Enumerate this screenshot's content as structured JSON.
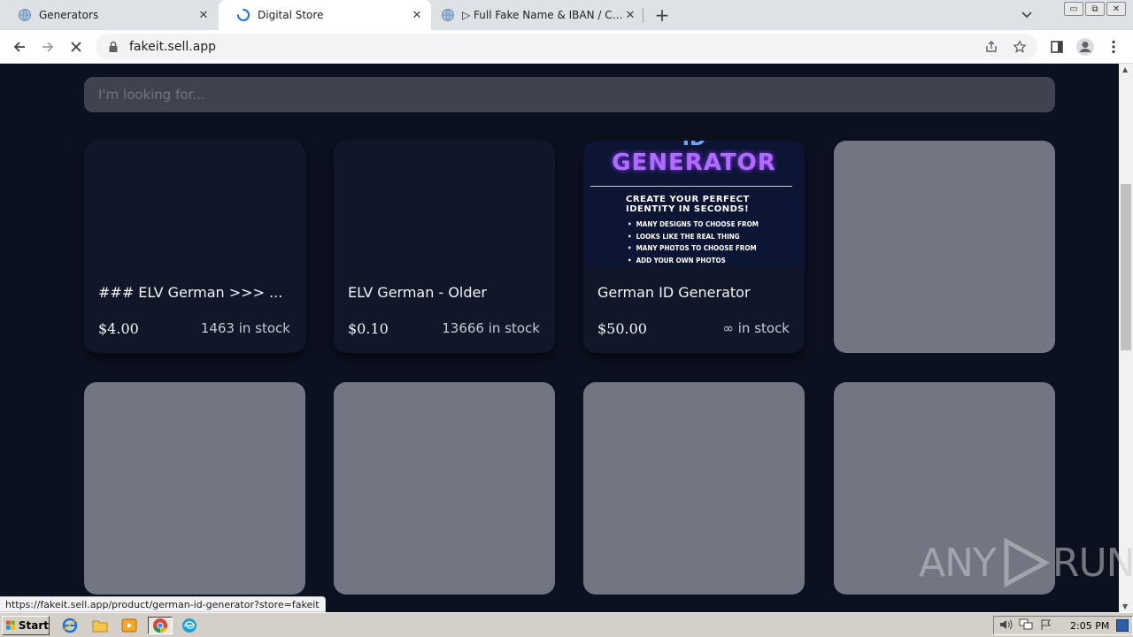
{
  "browser": {
    "tabs": [
      {
        "title": "Generators",
        "active": false,
        "loading": false
      },
      {
        "title": "Digital Store",
        "active": true,
        "loading": true
      },
      {
        "title": "▷ Full Fake Name & IBAN / Credit Ca",
        "active": false,
        "loading": false
      }
    ],
    "url": "fakeit.sell.app",
    "status_url": "https://fakeit.sell.app/product/german-id-generator?store=fakeit"
  },
  "page": {
    "search_placeholder": "I'm looking for...",
    "products": [
      {
        "name": "### ELV German >>> ...",
        "price": "$4.00",
        "stock": "1463 in stock"
      },
      {
        "name": "ELV German - Older",
        "price": "$0.10",
        "stock": "13666 in stock"
      },
      {
        "name": "German ID Generator",
        "price": "$50.00",
        "stock": "∞ in stock"
      }
    ],
    "promo_image": {
      "heading": "GENERATOR",
      "top_clip": "ID",
      "subheading_line1": "CREATE YOUR PERFECT",
      "subheading_line2": "IDENTITY IN SECONDS!",
      "bullets": [
        "MANY DESIGNS TO CHOOSE FROM",
        "LOOKS LIKE THE REAL THING",
        "MANY PHOTOS TO CHOOSE FROM",
        "ADD YOUR OWN PHOTOS"
      ]
    }
  },
  "watermark": {
    "left": "ANY",
    "right": "RUN"
  },
  "taskbar": {
    "start_label": "Start",
    "clock": "2:05 PM"
  },
  "colors": {
    "page_bg": "#0c1120",
    "card_bg": "#101729",
    "placeholder_card": "#737682",
    "search_bg": "#3f4350"
  }
}
